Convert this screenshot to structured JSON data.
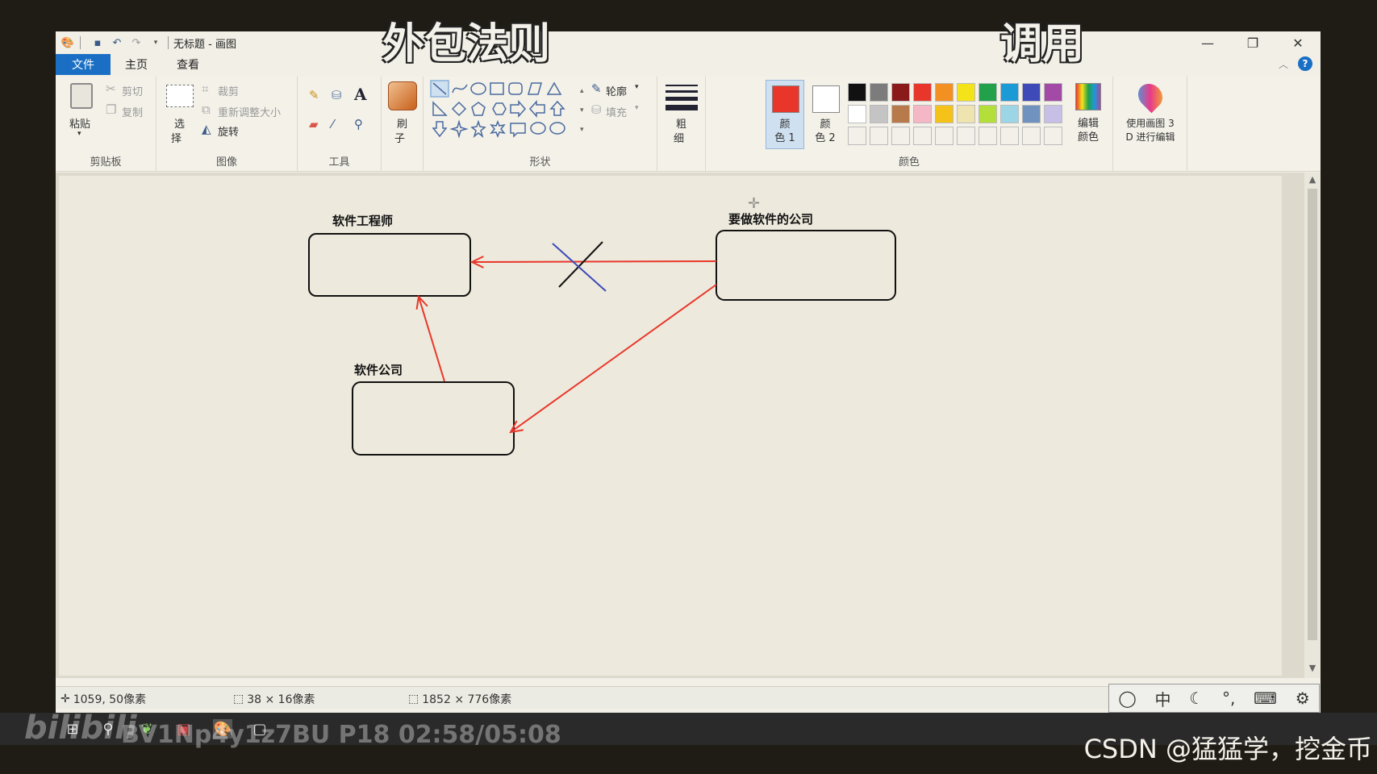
{
  "window": {
    "title": "无标题 - 画图",
    "controls": {
      "minimize": "—",
      "maximize": "❐",
      "close": "✕"
    }
  },
  "tabs": [
    {
      "label": "文件"
    },
    {
      "label": "主页"
    },
    {
      "label": "查看"
    }
  ],
  "ribbon": {
    "clipboard": {
      "paste": "粘贴",
      "cut": "剪切",
      "copy": "复制",
      "group": "剪贴板"
    },
    "image": {
      "select_line1": "选",
      "select_line2": "择",
      "crop": "裁剪",
      "resize": "重新调整大小",
      "rotate": "旋转",
      "group": "图像"
    },
    "tools": {
      "group": "工具",
      "text_tool": "A"
    },
    "brushes": {
      "line1": "刷",
      "line2": "子"
    },
    "shapes": {
      "outline": "轮廓",
      "fill": "填充",
      "group": "形状"
    },
    "size": {
      "line1": "粗",
      "line2": "细"
    },
    "color1": {
      "line1": "颜",
      "line2": "色 1",
      "color": "#e8372a"
    },
    "color2": {
      "line1": "颜",
      "line2": "色 2",
      "color": "#ffffff"
    },
    "edit_colors": {
      "line1": "编辑",
      "line2": "颜色"
    },
    "paint3d": {
      "line1": "使用画图 3",
      "line2": "D 进行编辑"
    },
    "colors_group": "颜色",
    "palette": [
      "#111111",
      "#7c7c7c",
      "#8b1a1a",
      "#e8372a",
      "#f39022",
      "#f5e31a",
      "#23a04a",
      "#1b9ad6",
      "#3d4ab8",
      "#a24aa6",
      "#ffffff",
      "#c4c4c4",
      "#b87a4b",
      "#f5b6c6",
      "#f5c21a",
      "#efe4b0",
      "#b4df3a",
      "#9cd6e6",
      "#7092be",
      "#c8bfe7",
      "#f2f0e8",
      "#f2f0e8",
      "#f2f0e8",
      "#f2f0e8",
      "#f2f0e8",
      "#f2f0e8",
      "#f2f0e8",
      "#f2f0e8",
      "#f2f0e8",
      "#f2f0e8"
    ]
  },
  "diagram": {
    "box1_label": "软件工程师",
    "box2_label": "要做软件的公司",
    "box3_label": "软件公司",
    "arrow_color": "#e8372a",
    "cross_colors": [
      "#111111",
      "#3d4ab8"
    ]
  },
  "status": {
    "cursor_pos": "1059, 50像素",
    "selection_size": "38 × 16像素",
    "canvas_size": "1852 × 776像素"
  },
  "overlay": {
    "title_left": "外包法则",
    "title_right": "调用",
    "bili_watermark": "BV1Np4y1z7BU P18 02:58/05:08",
    "csdn": "CSDN @猛猛学，挖金币"
  }
}
